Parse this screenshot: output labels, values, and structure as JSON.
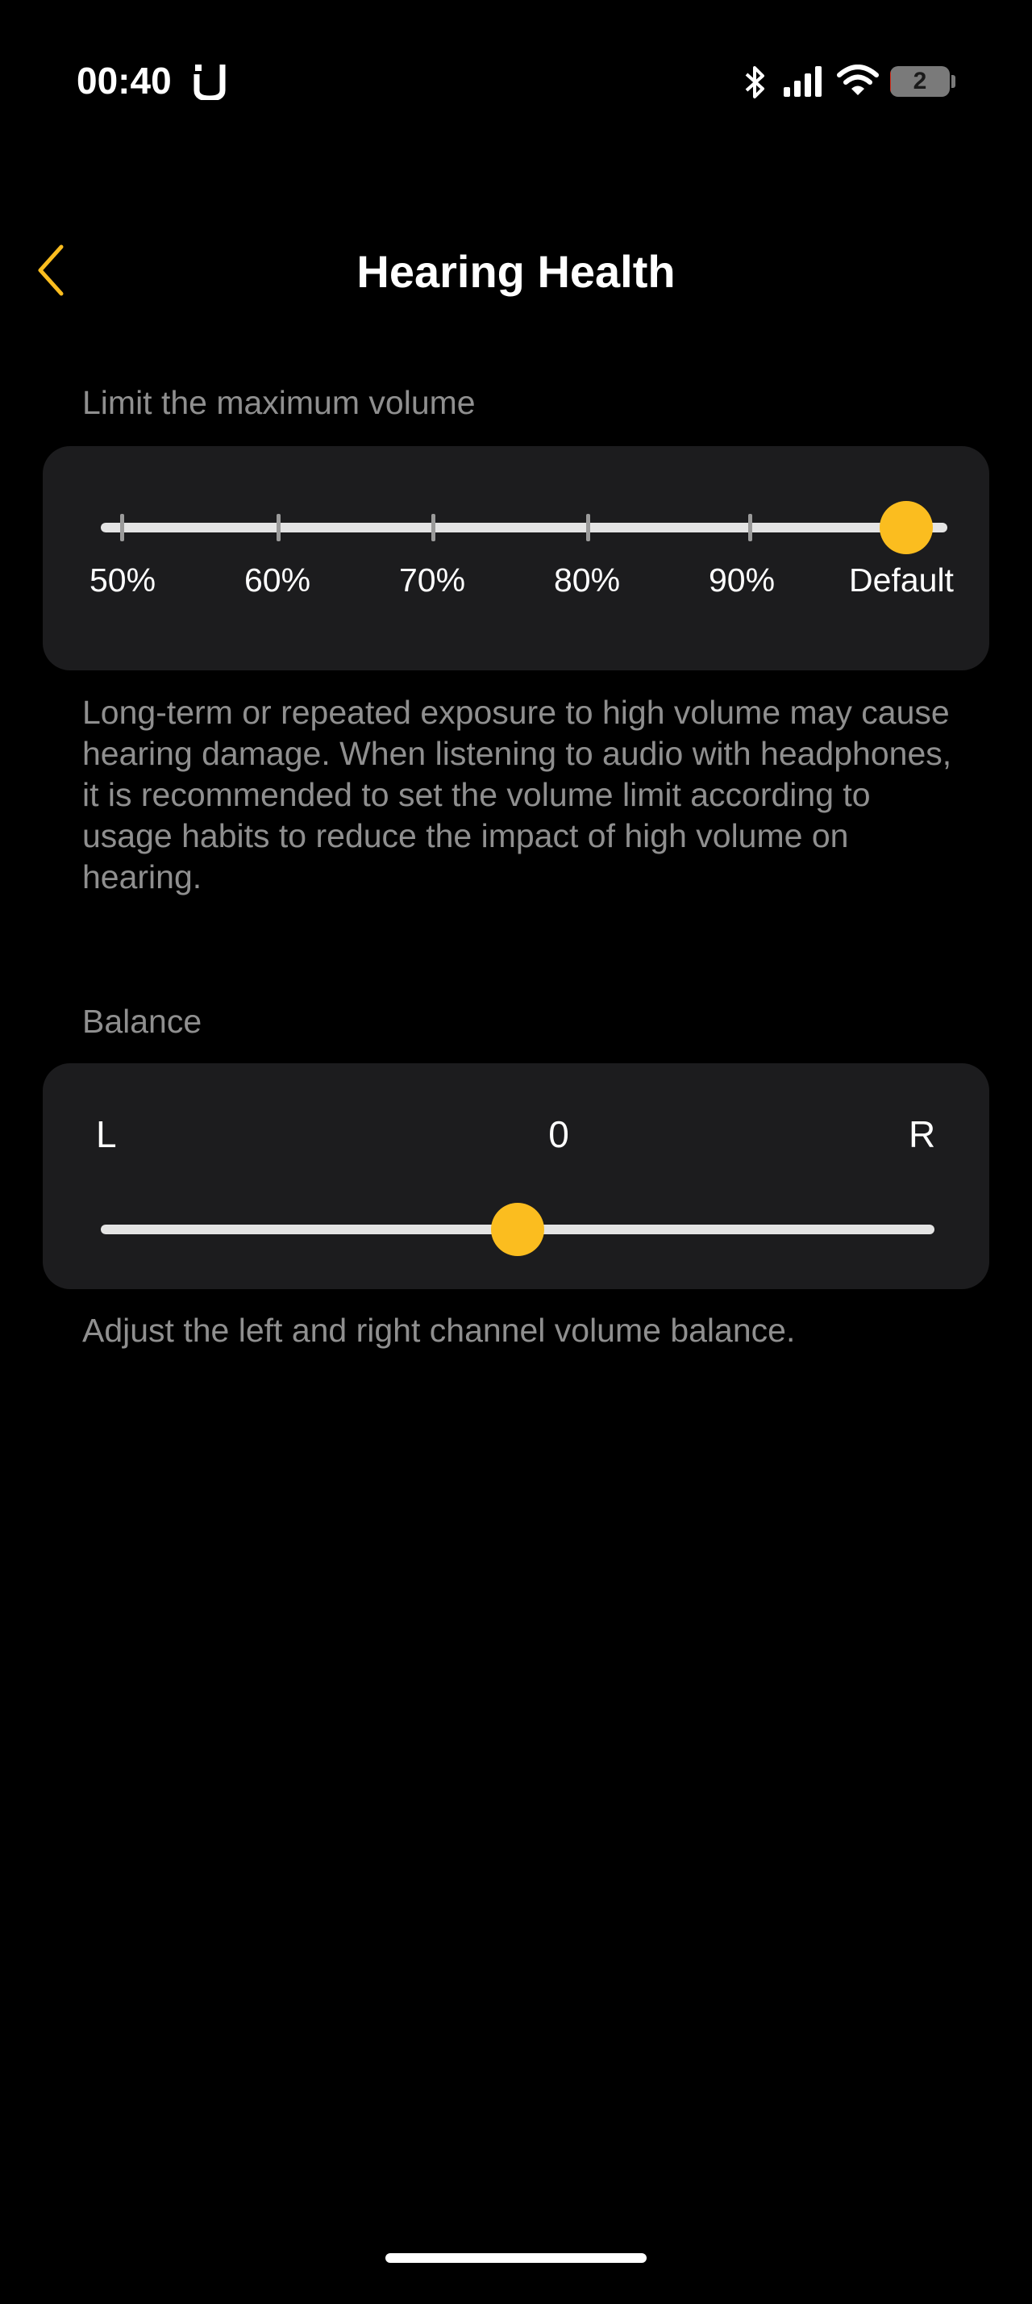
{
  "status_bar": {
    "time": "00:40",
    "battery_level": "2",
    "app_icon": "u-icon",
    "icons": [
      "bluetooth-icon",
      "signal-icon",
      "wifi-icon",
      "battery-icon"
    ]
  },
  "header": {
    "title": "Hearing Health",
    "back_icon": "chevron-left-icon"
  },
  "volume_limit": {
    "label": "Limit the maximum volume",
    "options": [
      "50%",
      "60%",
      "70%",
      "80%",
      "90%",
      "Default"
    ],
    "selected": "Default",
    "description": "Long-term or repeated exposure to high volume may cause hearing damage. When listening to audio with headphones, it is recommended to set the volume limit according to usage habits to reduce the impact of high volume on hearing."
  },
  "balance": {
    "label": "Balance",
    "left_label": "L",
    "right_label": "R",
    "value": "0",
    "position": 0.5,
    "description": "Adjust the left and right channel volume balance."
  },
  "colors": {
    "accent": "#fbbd1f",
    "background": "#000000",
    "card": "#1c1c1e",
    "secondary_text": "#8f8f8f",
    "track": "#e4e4e4"
  }
}
